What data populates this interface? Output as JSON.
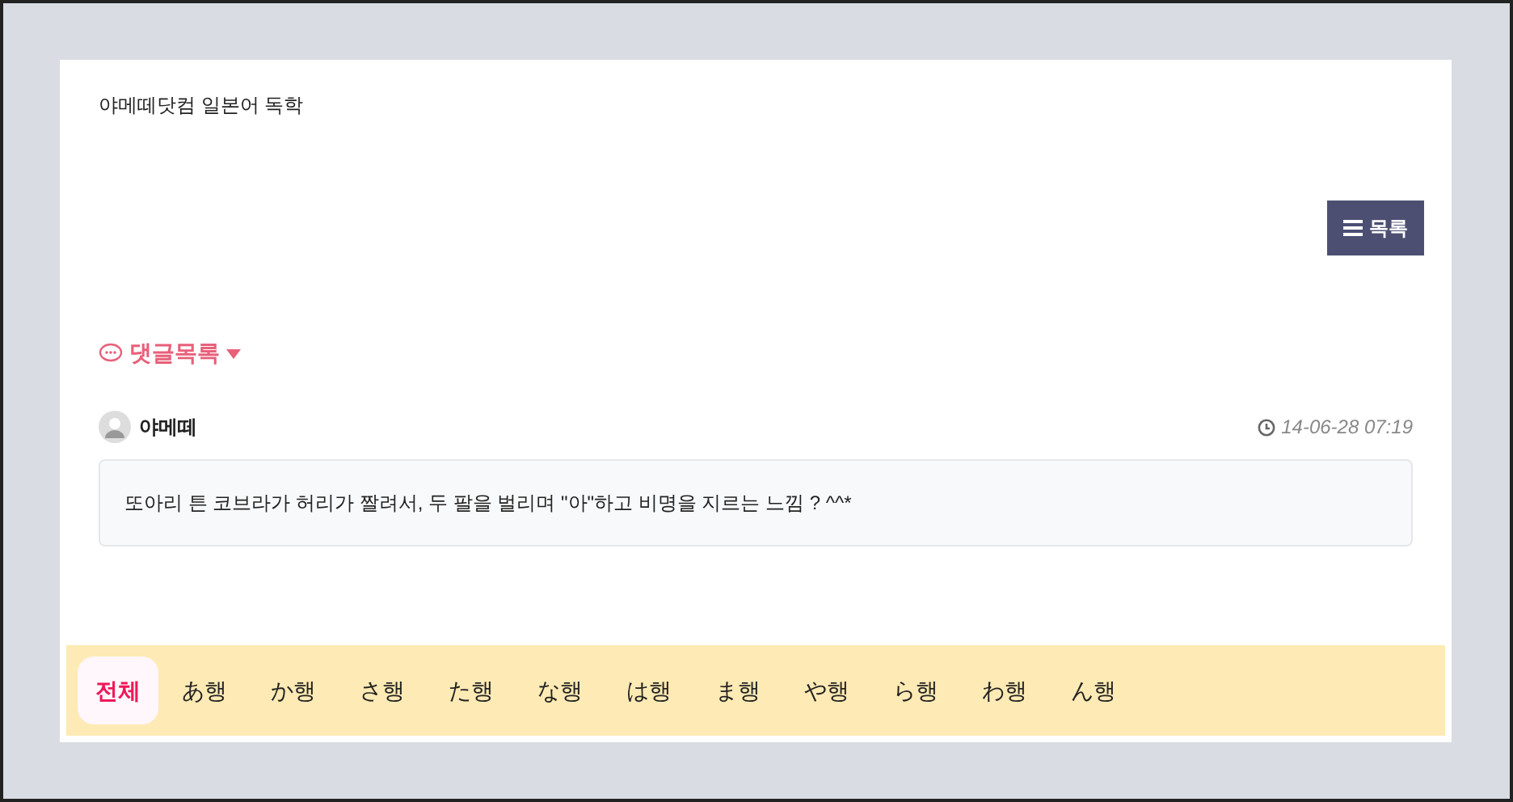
{
  "title": "야메떼닷컴 일본어 독학",
  "list_button": {
    "label": "목록"
  },
  "comments_header": {
    "label": "댓글목록",
    "expanded": true
  },
  "comments": [
    {
      "author": "야메떼",
      "time": "14-06-28 07:19",
      "text": "또아리 튼 코브라가 허리가 짤려서, 두 팔을 벌리며 \"아\"하고 비명을 지르는 느낌 ? ^^*"
    }
  ],
  "tabs": [
    {
      "label": "전체",
      "selected": true
    },
    {
      "label": "あ행",
      "selected": false
    },
    {
      "label": "か행",
      "selected": false
    },
    {
      "label": "さ행",
      "selected": false
    },
    {
      "label": "た행",
      "selected": false
    },
    {
      "label": "な행",
      "selected": false
    },
    {
      "label": "は행",
      "selected": false
    },
    {
      "label": "ま행",
      "selected": false
    },
    {
      "label": "や행",
      "selected": false
    },
    {
      "label": "ら행",
      "selected": false
    },
    {
      "label": "わ행",
      "selected": false
    },
    {
      "label": "ん행",
      "selected": false
    }
  ]
}
